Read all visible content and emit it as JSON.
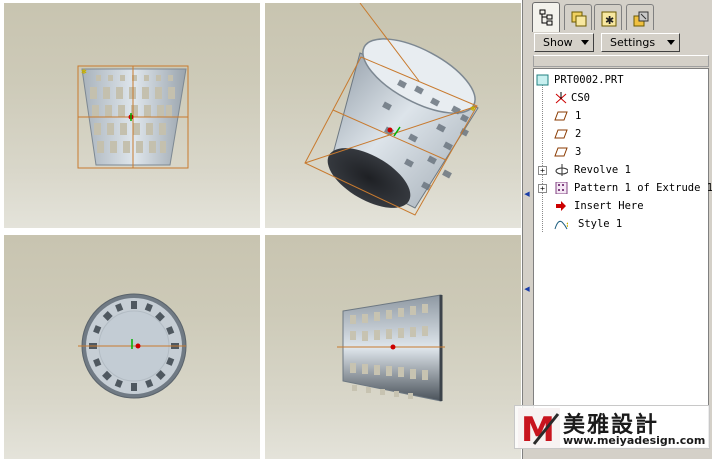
{
  "panel": {
    "tabs": [
      {
        "icon": "model-tree-icon",
        "active": true
      },
      {
        "icon": "layers-icon"
      },
      {
        "icon": "favorites-icon"
      },
      {
        "icon": "folder-browser-icon"
      }
    ],
    "show_label": "Show",
    "settings_label": "Settings",
    "tree": [
      {
        "label": "PRT0002.PRT",
        "icon": "part-icon"
      },
      {
        "label": "CS0",
        "icon": "csys-icon"
      },
      {
        "label": "1",
        "icon": "datum-plane-icon"
      },
      {
        "label": "2",
        "icon": "datum-plane-icon"
      },
      {
        "label": "3",
        "icon": "datum-plane-icon"
      },
      {
        "label": "Revolve 1",
        "icon": "revolve-icon"
      },
      {
        "label": "Pattern 1 of Extrude 1",
        "icon": "pattern-icon"
      },
      {
        "label": "Insert Here",
        "icon": "insert-arrow-icon"
      },
      {
        "label": "Style 1",
        "icon": "style-icon"
      }
    ]
  },
  "viewports": [
    "front",
    "isometric",
    "top",
    "side"
  ],
  "watermark": {
    "logo_text": "M",
    "title": "美雅設計",
    "url": "www.meiyadesign.com"
  },
  "colors": {
    "datum_outline": "#c87a2e",
    "insert_arrow": "#cc0000",
    "accent": "#1b3ea8"
  }
}
